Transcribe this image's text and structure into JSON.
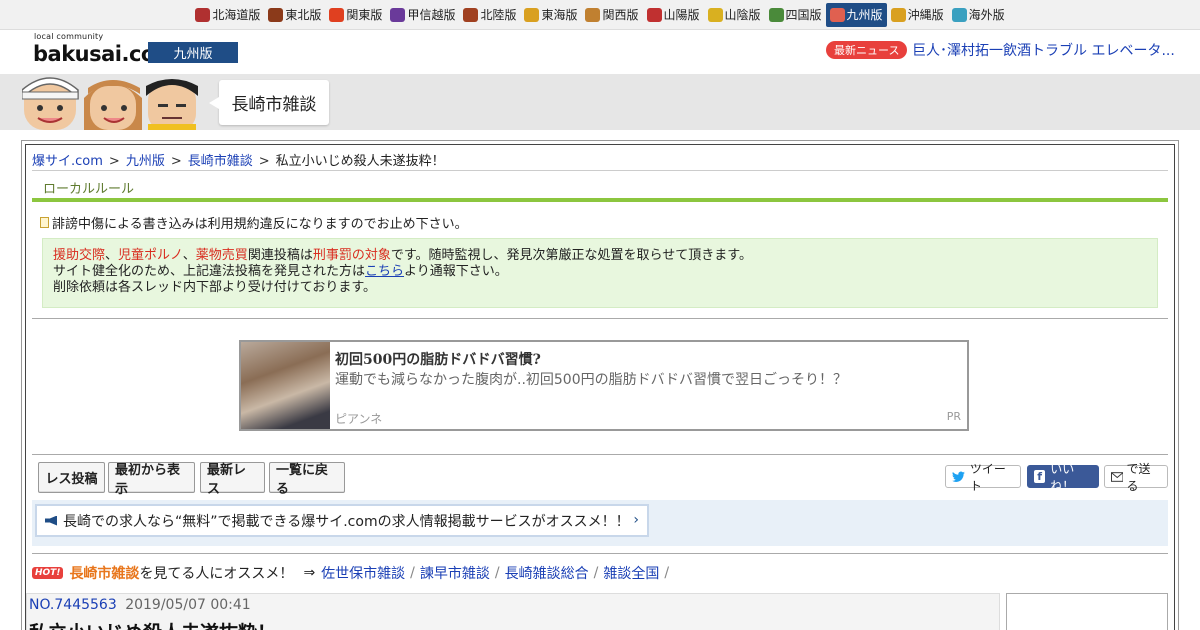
{
  "regions": [
    {
      "label": "北海道版",
      "icon": "crane-icon",
      "color": "#b03030"
    },
    {
      "label": "東北版",
      "icon": "namahage-icon",
      "color": "#8b3a1a"
    },
    {
      "label": "関東版",
      "icon": "tower-icon",
      "color": "#e04020"
    },
    {
      "label": "甲信越版",
      "icon": "grape-icon",
      "color": "#6a3a9a"
    },
    {
      "label": "北陸版",
      "icon": "gate-icon",
      "color": "#a04020"
    },
    {
      "label": "東海版",
      "icon": "shachihoko-icon",
      "color": "#d9a020"
    },
    {
      "label": "関西版",
      "icon": "takoyaki-icon",
      "color": "#c08030"
    },
    {
      "label": "山陽版",
      "icon": "shrine-icon",
      "color": "#c03030"
    },
    {
      "label": "山陰版",
      "icon": "sand-icon",
      "color": "#d9b020"
    },
    {
      "label": "四国版",
      "icon": "udon-icon",
      "color": "#4a8a3a"
    },
    {
      "label": "九州版",
      "icon": "fish-icon",
      "color": "#e06050",
      "active": true
    },
    {
      "label": "沖縄版",
      "icon": "shisa-icon",
      "color": "#d9a020"
    },
    {
      "label": "海外版",
      "icon": "globe-icon",
      "color": "#3aa0c0"
    }
  ],
  "header": {
    "logo_small": "local community",
    "logo": "bakusai.com",
    "edition": "九州版",
    "news_badge": "最新ニュース",
    "news_text": "巨人･澤村拓一飲酒トラブル エレベータ..."
  },
  "banner": {
    "board_name": "長崎市雑談"
  },
  "breadcrumb": {
    "items": [
      "爆サイ.com",
      "九州版",
      "長崎市雑談"
    ],
    "current": "私立小いじめ殺人未遂抜粋！",
    "sep": ">"
  },
  "local_rule": "ローカルルール",
  "notice1": "誹謗中傷による書き込みは利用規約違反になりますのでお止め下さい。",
  "warning": {
    "w1": "援助交際",
    "s1": "、",
    "w2": "児童ポルノ",
    "s2": "、",
    "w3": "薬物売買",
    "t1": "関連投稿は",
    "w4": "刑事罰の対象",
    "t2": "です。随時監視し、発見次第厳正な処置を取らせて頂きます。",
    "line2_pre": "サイト健全化のため、上記違法投稿を発見された方は",
    "line2_link": "こちら",
    "line2_post": "より通報下さい。",
    "line3": "削除依頼は各スレッド内下部より受け付けております。"
  },
  "ad": {
    "title": "初回500円の脂肪ドバドバ習慣?",
    "desc": "運動でも減らなかった腹肉が..初回500円の脂肪ドバドバ習慣で翌日ごっそり！？",
    "source": "ピアンネ",
    "pr": "PR"
  },
  "buttons": {
    "post": "レス投稿",
    "from_start": "最初から表示",
    "latest": "最新レス",
    "back": "一覧に戻る"
  },
  "share": {
    "tweet": "ツイート",
    "like": "いいね！",
    "send": "で送る"
  },
  "promo": "長崎での求人なら“無料”で掲載できる爆サイ.comの求人情報掲載サービスがオススメ！！",
  "recommend": {
    "hot": "HOT!",
    "board": "長崎市雑談",
    "text": "を見てる人にオススメ！",
    "arrow": "⇒",
    "links": [
      "佐世保市雑談",
      "諫早市雑談",
      "長崎雑談総合",
      "雑談全国"
    ],
    "sep": "/"
  },
  "thread": {
    "no": "NO.7445563",
    "date": "2019/05/07 00:41",
    "title": "私立小いじめ殺人未遂抜粋！"
  }
}
